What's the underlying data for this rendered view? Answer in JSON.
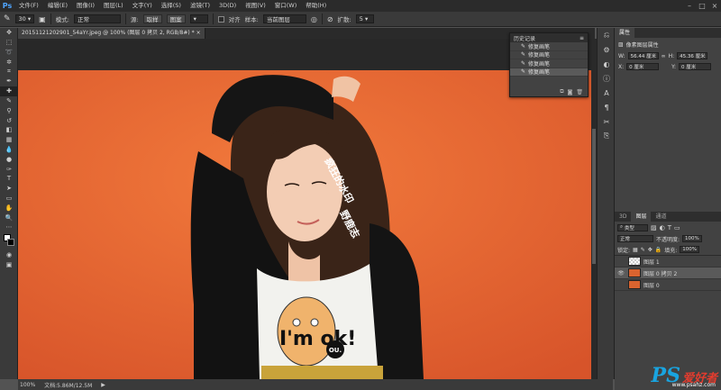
{
  "menubar": {
    "logo": "Ps",
    "items": [
      "文件(F)",
      "编辑(E)",
      "图像(I)",
      "图层(L)",
      "文字(Y)",
      "选择(S)",
      "滤镜(T)",
      "3D(D)",
      "视图(V)",
      "窗口(W)",
      "帮助(H)"
    ]
  },
  "options": {
    "brush_size": "30",
    "mode_label": "模式:",
    "mode_value": "正常",
    "source_label": "源:",
    "source_sampled": "取样",
    "source_pattern": "图案",
    "aligned_label": "对齐",
    "sample_label": "样本:",
    "sample_value": "当前图层",
    "diffusion_label": "扩散:",
    "diffusion_value": "5"
  },
  "document": {
    "tab_title": "20151121202901_54aYr.jpeg @ 100% (图层 0 拷贝 2, RGB/8#) *",
    "zoom": "100%",
    "doc_size": "文档:5.86M/12.5M"
  },
  "history": {
    "title": "历史记录",
    "items": [
      "修复画笔",
      "修复画笔",
      "修复画笔",
      "修复画笔"
    ]
  },
  "properties": {
    "tab": "属性",
    "subtitle": "像素图层属性",
    "w_label": "W:",
    "w_value": "56.44 厘米",
    "h_label": "H:",
    "h_value": "45.36 厘米",
    "x_label": "X:",
    "x_value": "0 厘米",
    "y_label": "Y:",
    "y_value": "0 厘米"
  },
  "layers_panel": {
    "tabs": [
      "3D",
      "图层",
      "通道"
    ],
    "active_tab": "图层",
    "filter_label": "类型",
    "blend_mode": "正常",
    "opacity_label": "不透明度:",
    "opacity_value": "100%",
    "lock_label": "锁定:",
    "fill_label": "填充:",
    "fill_value": "100%",
    "layers": [
      {
        "name": "图层 1",
        "visible": false,
        "selected": false
      },
      {
        "name": "图层 0 拷贝 2",
        "visible": true,
        "selected": true
      },
      {
        "name": "图层 0",
        "visible": false,
        "selected": false
      }
    ]
  },
  "photo": {
    "watermark_text_1": "疯狂的水印",
    "watermark_text_2": "野鹿志",
    "shirt_text": "I'm ok!",
    "shirt_badge": "OU."
  },
  "site_watermark": {
    "ps": "PS",
    "cn": "爱好者",
    "url": "www.psahz.com"
  },
  "colors": {
    "background": "#e86a32",
    "ui_dark": "#2b2b2b",
    "ui_panel": "#424242"
  }
}
